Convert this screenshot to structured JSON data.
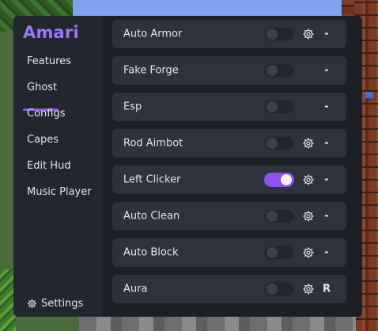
{
  "app": {
    "logo": "Amari"
  },
  "sidebar": {
    "items": [
      {
        "label": "Features"
      },
      {
        "label": "Ghost"
      },
      {
        "label": "Configs"
      },
      {
        "label": "Capes"
      },
      {
        "label": "Edit Hud"
      },
      {
        "label": "Music Player"
      }
    ],
    "active": "Ghost",
    "settings_label": "Settings"
  },
  "modules": [
    {
      "name": "Auto Armor",
      "enabled": false,
      "has_settings": true,
      "key": "-"
    },
    {
      "name": "Fake Forge",
      "enabled": false,
      "has_settings": false,
      "key": "-"
    },
    {
      "name": "Esp",
      "enabled": false,
      "has_settings": false,
      "key": "-"
    },
    {
      "name": "Rod Aimbot",
      "enabled": false,
      "has_settings": true,
      "key": "-"
    },
    {
      "name": "Left Clicker",
      "enabled": true,
      "has_settings": true,
      "key": "-"
    },
    {
      "name": "Auto Clean",
      "enabled": false,
      "has_settings": true,
      "key": "-"
    },
    {
      "name": "Auto Block",
      "enabled": false,
      "has_settings": true,
      "key": "-"
    },
    {
      "name": "Aura",
      "enabled": false,
      "has_settings": true,
      "key": "R"
    }
  ],
  "colors": {
    "accent": "#9050f0",
    "logo": "#9a78f2",
    "panel_bg": "#1c1f26",
    "sidebar_bg": "#22262e",
    "row_bg": "#2e323b",
    "text": "#e4e6ea"
  },
  "icons": {
    "settings": "gear-icon",
    "module_settings": "gear-icon"
  }
}
